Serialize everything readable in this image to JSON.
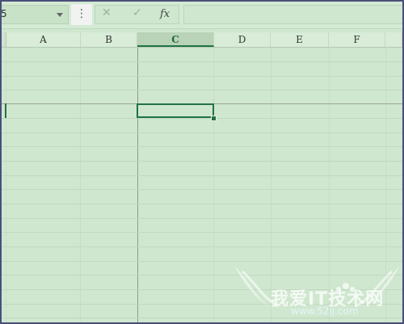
{
  "name_box": {
    "value": "5"
  },
  "formula_bar": {
    "more_glyph": "⋮",
    "cancel_glyph": "✕",
    "enter_glyph": "✓",
    "function_glyph": "fx",
    "value": ""
  },
  "columns": [
    "A",
    "B",
    "C",
    "D",
    "E",
    "F"
  ],
  "active_column": "C",
  "watermark": {
    "text": "我爱IT技术网",
    "url": "www.52ij.com"
  },
  "colors": {
    "accent": "#217346",
    "sheet_bg": "#cfe7cf"
  }
}
